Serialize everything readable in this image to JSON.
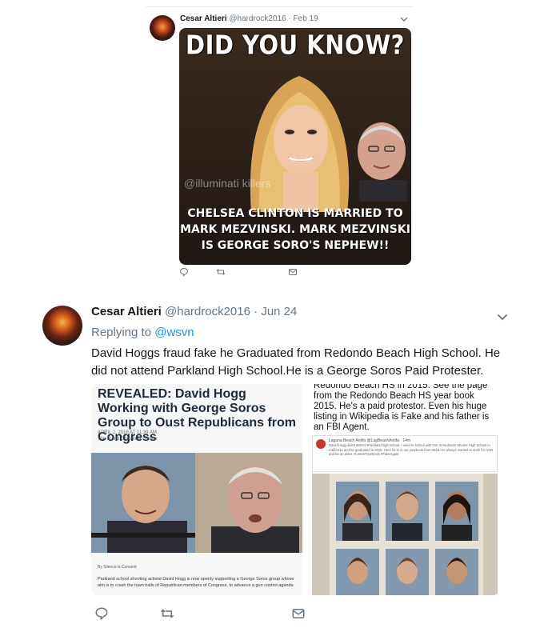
{
  "tweet1": {
    "author_name": "Cesar Altieri",
    "handle": "@hardrock2016",
    "separator": "·",
    "date": "Feb 19",
    "image": {
      "headline": "DID YOU KNOW?",
      "watermark": "@illuminati killers",
      "caption_lines": [
        "CHELSEA CLINTON IS MARRIED TO",
        "MARK MEZVINSKI. MARK MEZVINSKI",
        "IS GEORGE SORO'S NEPHEW!!"
      ]
    },
    "actions": [
      "reply-icon",
      "retweet-icon",
      "message-icon"
    ]
  },
  "tweet2": {
    "author_name": "Cesar Altieri",
    "handle": "@hardrock2016",
    "separator": "·",
    "date": "Jun 24",
    "replying_prefix": "Replying to",
    "replying_to": "@wsvn",
    "text": "David Hoggs fraud fake he Graduated from Redondo Beach High School. He did not attend Parkland High School.He is a George Soros Paid Protester.",
    "media_left": {
      "title": "REVEALED: David Hogg Working with George Soros Group to Oust Republicans from Congress",
      "date": "APRIL 2, 2018 AT 11:39 AM",
      "source": "The Event Chronicle / Editor",
      "byline": "By Silence is Consent",
      "body": "Parkland school shooting activist David Hogg is now openly supporting a George Soros group whose aim is to crash the town halls of Republican members of Congress, to advance a gun control agenda"
    },
    "media_right": {
      "text": "Redondo Beach HS in 2015. See the page from the Redondo Beach HS year book 2015. He's a paid protestor. Even his huge listing in Wikipedia is Fake and his father is an FBI Agent.",
      "card_name": "Laguna Beach Antifa @LagBeachAntifa · 14m",
      "card_body": "David Hogg didn't attend #Parkland high school. I used to school with him at Redondo Shores High School in California and he graduated in 2015. Here he is in our yearbook from 2015. He always wanted to work for CNN and be an actor. #LostInYourNews #FakeAgain"
    },
    "actions": [
      "reply-icon",
      "retweet-icon",
      "message-icon"
    ]
  },
  "colors": {
    "link": "#1b95e0",
    "muted": "#657786",
    "text": "#14171a"
  }
}
